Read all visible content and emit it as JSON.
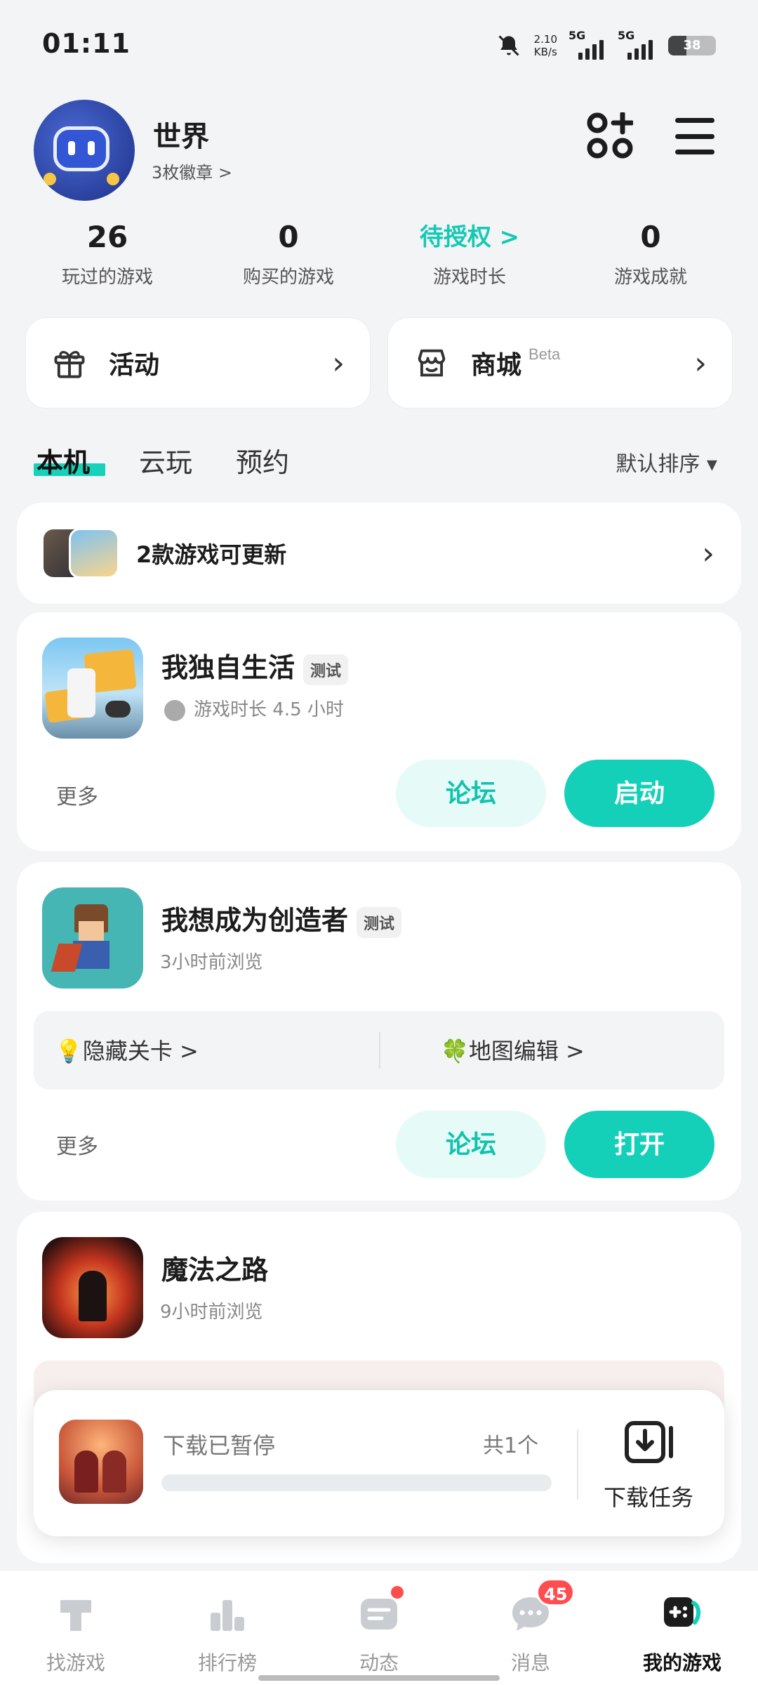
{
  "status_bar": {
    "time": "01:11",
    "net_speed": "2.10",
    "net_unit": "KB/s",
    "sim1": "5G",
    "sim2": "5G",
    "battery": "38"
  },
  "profile": {
    "username": "世界",
    "badges": "3枚徽章 >"
  },
  "stats": [
    {
      "value": "26",
      "label": "玩过的游戏"
    },
    {
      "value": "0",
      "label": "购买的游戏"
    },
    {
      "value": "待授权 >",
      "label": "游戏时长"
    },
    {
      "value": "0",
      "label": "游戏成就"
    }
  ],
  "quick": {
    "activity": "活动",
    "store": "商城",
    "store_badge": "Beta"
  },
  "tabs": [
    "本机",
    "云玩",
    "预约"
  ],
  "sort_label": "默认排序 ▾",
  "update_banner": "2款游戏可更新",
  "games": [
    {
      "title": "我独自生活",
      "tag": "测试",
      "subtitle": "游戏时长 4.5 小时",
      "more": "更多",
      "forum": "论坛",
      "action": "启动"
    },
    {
      "title": "我想成为创造者",
      "tag": "测试",
      "subtitle": "3小时前浏览",
      "shortcuts": [
        "💡隐藏关卡 >",
        "🍀地图编辑 >"
      ],
      "more": "更多",
      "forum": "论坛",
      "action": "打开"
    },
    {
      "title": "魔法之路",
      "subtitle": "9小时前浏览"
    }
  ],
  "download": {
    "status": "下载已暂停",
    "count": "共1个",
    "task_label": "下载任务",
    "progress": 0
  },
  "bottom_nav": [
    {
      "label": "找游戏",
      "icon": "find-game-icon"
    },
    {
      "label": "排行榜",
      "icon": "ranking-icon"
    },
    {
      "label": "动态",
      "icon": "feed-icon"
    },
    {
      "label": "消息",
      "icon": "message-icon",
      "badge": "45"
    },
    {
      "label": "我的游戏",
      "icon": "my-games-icon"
    }
  ],
  "colors": {
    "accent": "#15d0b9",
    "accent_light": "#e6fbf8",
    "badge_red": "#ff4d4f"
  }
}
